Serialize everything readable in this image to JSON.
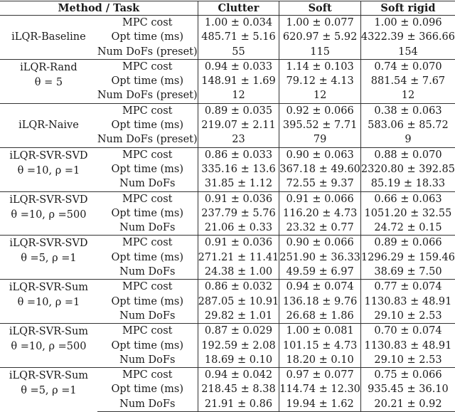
{
  "header": {
    "method_task": "Method / Task",
    "tasks": [
      "Clutter",
      "Soft",
      "Soft rigid"
    ]
  },
  "groups": [
    {
      "method": "iLQR-Baseline",
      "param": "",
      "metrics": [
        "MPC cost",
        "Opt time (ms)",
        "Num DoFs (preset)"
      ],
      "values": [
        [
          "1.00 ± 0.034",
          "1.00 ± 0.077",
          "1.00 ± 0.096"
        ],
        [
          "485.71 ± 5.16",
          "620.97 ± 5.92",
          "4322.39 ± 366.66"
        ],
        [
          "55",
          "115",
          "154"
        ]
      ],
      "bold": []
    },
    {
      "method": "iLQR-Rand",
      "param": "θ = 5",
      "metrics": [
        "MPC cost",
        "Opt time (ms)",
        "Num DoFs (preset)"
      ],
      "values": [
        [
          "0.94 ± 0.033",
          "1.14 ± 0.103",
          "0.74 ± 0.070"
        ],
        [
          "148.91 ± 1.69",
          "79.12 ± 4.13",
          "881.54 ± 7.67"
        ],
        [
          "12",
          "12",
          "12"
        ]
      ],
      "bold": []
    },
    {
      "method": "iLQR-Naive",
      "param": "",
      "metrics": [
        "MPC cost",
        "Opt time (ms)",
        "Num DoFs (preset)"
      ],
      "values": [
        [
          "0.89 ± 0.035",
          "0.92 ± 0.066",
          "0.38 ± 0.063"
        ],
        [
          "219.07 ± 2.11",
          "395.52 ± 7.71",
          "583.06 ± 85.72"
        ],
        [
          "23",
          "79",
          "9"
        ]
      ],
      "bold": [
        [
          0,
          2
        ]
      ]
    },
    {
      "method": "iLQR-SVR-SVD",
      "param": "θ =10, ρ =1",
      "metrics": [
        "MPC cost",
        "Opt time (ms)",
        "Num DoFs"
      ],
      "values": [
        [
          "0.86 ± 0.033",
          "0.90 ± 0.063",
          "0.88 ± 0.070"
        ],
        [
          "335.16 ± 13.6",
          "367.18 ± 49.60",
          "2320.80 ± 392.85"
        ],
        [
          "31.85 ± 1.12",
          "72.55 ± 9.37",
          "85.19 ± 18.33"
        ]
      ],
      "bold": [
        [
          0,
          0
        ],
        [
          0,
          1
        ]
      ]
    },
    {
      "method": "iLQR-SVR-SVD",
      "param": "θ =10, ρ =500",
      "metrics": [
        "MPC cost",
        "Opt time (ms)",
        "Num DoFs"
      ],
      "values": [
        [
          "0.91 ± 0.036",
          "0.91 ± 0.066",
          "0.66 ± 0.063"
        ],
        [
          "237.79 ± 5.76",
          "116.20 ± 4.73",
          "1051.20 ± 32.55"
        ],
        [
          "21.06 ± 0.33",
          "23.32 ± 0.77",
          "24.72 ± 0.15"
        ]
      ],
      "bold": []
    },
    {
      "method": "iLQR-SVR-SVD",
      "param": "θ =5, ρ =1",
      "metrics": [
        "MPC cost",
        "Opt time (ms)",
        "Num DoFs"
      ],
      "values": [
        [
          "0.91 ± 0.036",
          "0.90 ± 0.066",
          "0.89 ± 0.066"
        ],
        [
          "271.21 ± 11.41",
          "251.90 ± 36.33",
          "1296.29 ± 159.46"
        ],
        [
          "24.38 ± 1.00",
          "49.59 ± 6.97",
          "38.69 ± 7.50"
        ]
      ],
      "bold": []
    },
    {
      "method": "iLQR-SVR-Sum",
      "param": "θ =10, ρ =1",
      "metrics": [
        "MPC cost",
        "Opt time (ms)",
        "Num DoFs"
      ],
      "values": [
        [
          "0.86 ± 0.032",
          "0.94 ± 0.074",
          "0.77 ± 0.074"
        ],
        [
          "287.05 ± 10.91",
          "136.18 ± 9.76",
          "1130.83 ± 48.91"
        ],
        [
          "29.82 ± 1.01",
          "26.68 ± 1.86",
          "29.10 ± 2.53"
        ]
      ],
      "bold": []
    },
    {
      "method": "iLQR-SVR-Sum",
      "param": "θ =10, ρ =500",
      "metrics": [
        "MPC cost",
        "Opt time (ms)",
        "Num DoFs"
      ],
      "values": [
        [
          "0.87 ± 0.029",
          "1.00 ± 0.081",
          "0.70 ± 0.074"
        ],
        [
          "192.59 ± 2.08",
          "101.15 ± 4.73",
          "1130.83 ± 48.91"
        ],
        [
          "18.69 ± 0.10",
          "18.20 ± 0.10",
          "29.10 ± 2.53"
        ]
      ],
      "bold": []
    },
    {
      "method": "iLQR-SVR-Sum",
      "param": "θ =5, ρ =1",
      "metrics": [
        "MPC cost",
        "Opt time (ms)",
        "Num DoFs"
      ],
      "values": [
        [
          "0.94 ± 0.042",
          "0.97 ± 0.077",
          "0.75 ± 0.066"
        ],
        [
          "218.45 ± 8.38",
          "114.74 ± 12.30",
          "935.45 ± 36.10"
        ],
        [
          "21.91 ± 0.86",
          "19.94 ± 1.62",
          "20.21 ± 0.92"
        ]
      ],
      "bold": []
    }
  ]
}
